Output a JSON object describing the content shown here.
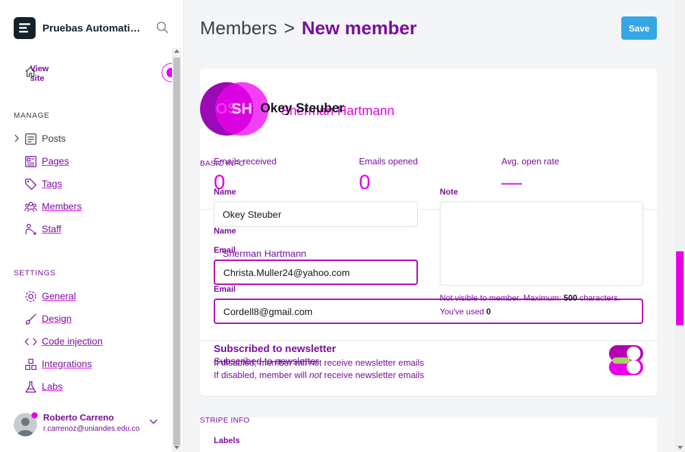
{
  "brand": {
    "title": "Pruebas Automatizadas"
  },
  "sidebar": {
    "view_site": "View site",
    "manage_label": "MANAGE",
    "settings_label": "SETTINGS",
    "manage_items": [
      {
        "label": "Posts",
        "icon": "posts-icon"
      },
      {
        "label": "Pages",
        "icon": "pages-icon"
      },
      {
        "label": "Tags",
        "icon": "tag-icon"
      },
      {
        "label": "Members",
        "icon": "members-icon"
      },
      {
        "label": "Staff",
        "icon": "staff-icon"
      }
    ],
    "settings_items": [
      {
        "label": "General",
        "icon": "gear-icon"
      },
      {
        "label": "Design",
        "icon": "brush-icon"
      },
      {
        "label": "Code injection",
        "icon": "code-icon"
      },
      {
        "label": "Integrations",
        "icon": "integrations-icon"
      },
      {
        "label": "Labs",
        "icon": "flask-icon"
      }
    ],
    "user": {
      "name": "Roberto Carreno",
      "email": "r.carrenoz@uniandes.edu.co"
    }
  },
  "header": {
    "parent": "Members",
    "separator": ">",
    "current": "New member",
    "save_label": "Save"
  },
  "member": {
    "initials_1": "OS",
    "initials_2": "SH",
    "name_1": "Okey Steuber",
    "name_2": "Sherman Hartmann"
  },
  "stats": {
    "emails_received_label": "Emails received",
    "emails_received_value": "0",
    "emails_opened_label": "Emails opened",
    "emails_opened_value": "0",
    "open_rate_label": "Avg. open rate",
    "open_rate_value": "—"
  },
  "form": {
    "section_label": "BASIC INFO",
    "name_label": "Name",
    "name_value": "Okey Steuber",
    "name_label_2": "Name",
    "name_value_2": "Sherman Hartmann",
    "email_label": "Email",
    "email_value": "Christa.Muller24@yahoo.com",
    "email_label_2": "Email",
    "email_value_2": "Cordell8@gmail.com",
    "note_label": "Note",
    "note_hint_prefix": "Not visible to member. Maximum: ",
    "note_max": "500",
    "note_hint_suffix": " characters.",
    "note_used_prefix": "You've used ",
    "note_used": "0"
  },
  "newsletter": {
    "title": "Subscribed to newsletter",
    "title_2": "Subscribed to newsletter",
    "hint_1": "If disabled, member will not receive newsletter emails",
    "hint_2_prefix": "If disabled, member will ",
    "hint_2_em": "not",
    "hint_2_suffix": " receive newsletter emails"
  },
  "stripe": {
    "section_label": "STRIPE INFO",
    "labels_label": "Labels"
  },
  "colors": {
    "accent": "#35a7e4",
    "overlay_pink": "#e800e8",
    "overlay_purple": "#7a0f9a"
  }
}
